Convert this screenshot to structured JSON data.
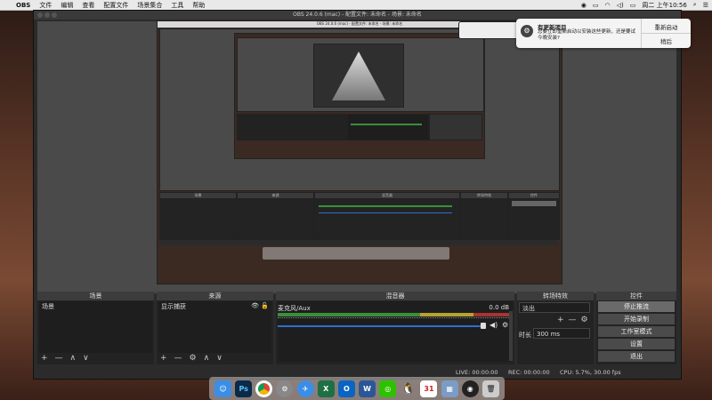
{
  "menubar": {
    "apple": "",
    "app": "OBS",
    "items": [
      "文件",
      "编辑",
      "查看",
      "配置文件",
      "场景集合",
      "工具",
      "帮助"
    ],
    "right": {
      "battery": "",
      "day_time": "周二 上午10:56"
    }
  },
  "window": {
    "title": "OBS 24.0.6 (mac) - 配置文件: 未命名 - 场景: 未命名"
  },
  "nested": {
    "title1": "OBS 24.0.6 (mac) - 配置文件: 未命名 - 场景: 未命名"
  },
  "notification": {
    "title": "有更新项目",
    "body": "您要立即重新启动以安装这些更新，还是要试今晚安装?",
    "btn_restart": "重新启动",
    "btn_later": "稍后"
  },
  "docks": {
    "scenes": {
      "title": "场景",
      "items": [
        "场景"
      ]
    },
    "sources": {
      "title": "来源",
      "items": [
        "显示捕获"
      ]
    },
    "mixer": {
      "title": "混音器",
      "track_name": "麦克风/Aux",
      "track_db": "0.0 dB"
    },
    "transitions": {
      "title": "转场特效",
      "type": "淡出",
      "duration_label": "时长",
      "duration_value": "300 ms"
    },
    "controls": {
      "title": "控件",
      "buttons": [
        "停止推流",
        "开始录制",
        "工作室模式",
        "设置",
        "退出"
      ]
    }
  },
  "foot": {
    "plus": "+",
    "minus": "—",
    "up": "∧",
    "down": "∨",
    "gear": "⚙"
  },
  "status": {
    "live": "LIVE: 00:00:00",
    "rec": "REC: 00:00:00",
    "cpu": "CPU: 5.7%, 30.00 fps"
  },
  "dock_icons": [
    "finder-icon",
    "photoshop-icon",
    "chrome-icon",
    "settings-icon",
    "safari-icon",
    "excel-icon",
    "outlook-icon",
    "word-icon",
    "wechat-icon",
    "qq-icon",
    "calendar-icon",
    "photos-icon",
    "obs-icon",
    "trash-icon"
  ],
  "dock_labels": {
    "ps": "Ps",
    "x": "X",
    "o": "O",
    "w": "W",
    "cal": "31"
  },
  "colors": {
    "accent_blue": "#2f6fcf",
    "meter_green": "#3a8f3a",
    "meter_yellow": "#b5a330",
    "meter_red": "#a33"
  }
}
